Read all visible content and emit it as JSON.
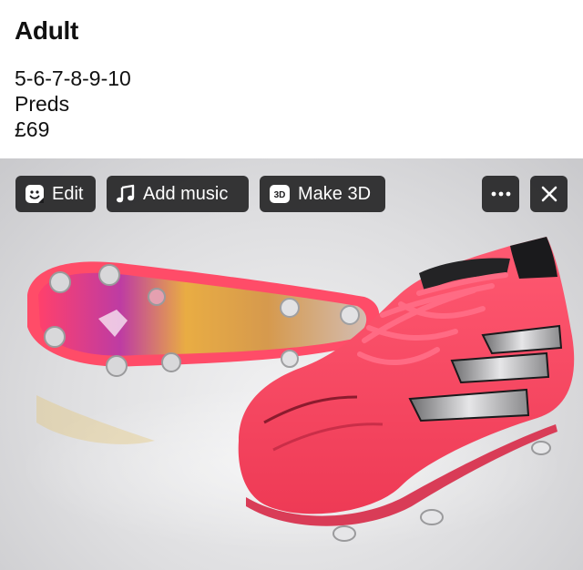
{
  "post": {
    "title": "Adult",
    "lines": [
      "5-6-7-8-9-10",
      "Preds",
      "£69"
    ]
  },
  "photo": {
    "toolbar": {
      "edit_label": "Edit",
      "music_label": "Add music",
      "make3d_label": "Make 3D",
      "make3d_badge": "3D",
      "more_icon": "more-icon",
      "close_icon": "close-icon"
    },
    "colors": {
      "boot": "#ff4a63",
      "boot_dark": "#e8334f",
      "stripe": "#cfd0d2",
      "sole_gold": "#d9b44a"
    }
  }
}
